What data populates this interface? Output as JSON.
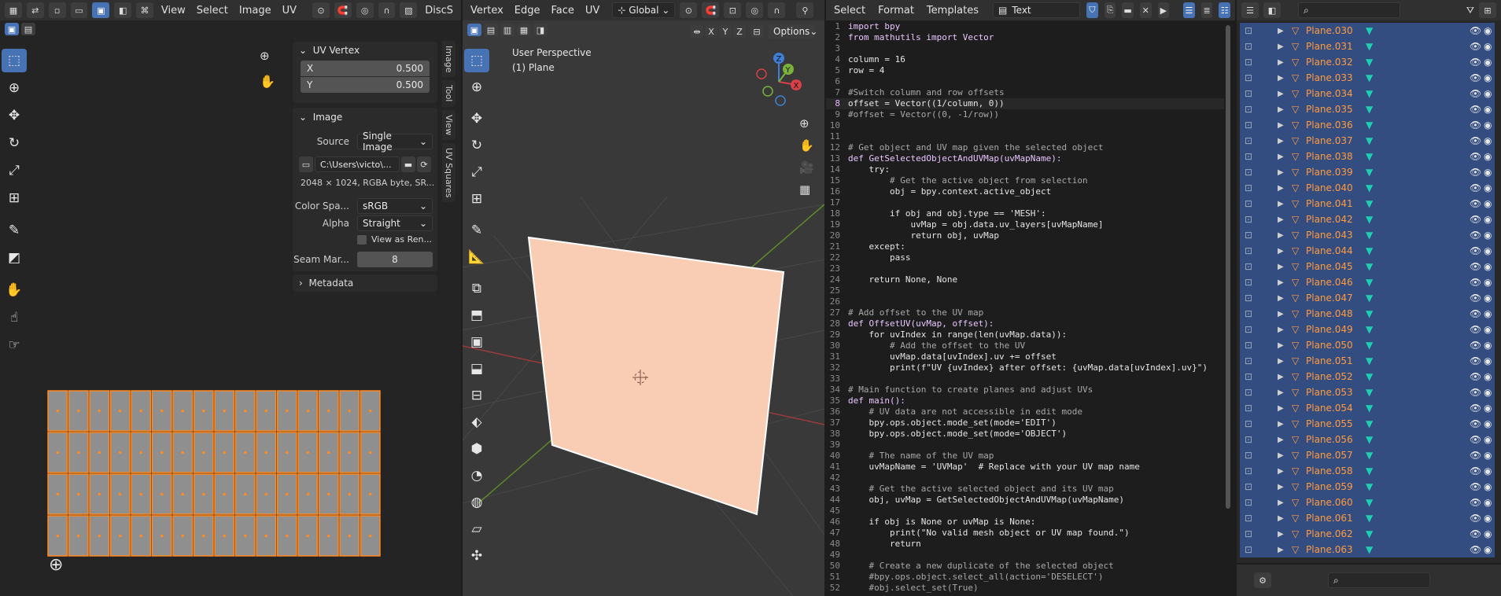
{
  "uv_editor": {
    "menus": [
      "View",
      "Select",
      "Image",
      "UV"
    ],
    "header_trunc": "DiscS",
    "tabs": [
      "Image",
      "Tool",
      "View",
      "UV Squares"
    ],
    "uv_vertex_panel": {
      "title": "UV Vertex",
      "x_label": "X",
      "x_value": "0.500",
      "y_label": "Y",
      "y_value": "0.500"
    },
    "image_panel": {
      "title": "Image",
      "source_label": "Source",
      "source_value": "Single Image",
      "path": "C:\\Users\\victo\\...",
      "info": "2048 × 1024,  RGBA byte,  SR...",
      "colorspace_label": "Color Spa...",
      "colorspace_value": "sRGB",
      "alpha_label": "Alpha",
      "alpha_value": "Straight",
      "view_as_render": "View as Ren...",
      "seam_label": "Seam Mar...",
      "seam_value": "8"
    },
    "metadata_title": "Metadata",
    "grid": {
      "columns": 16,
      "rows": 4
    }
  },
  "viewport": {
    "menus": [
      "Vertex",
      "Edge",
      "Face",
      "UV"
    ],
    "transform_orientation": "Global",
    "options": "Options",
    "axis_lock": [
      "X",
      "Y",
      "Z"
    ],
    "title": "User Perspective",
    "subtitle": "(1) Plane",
    "gizmo": {
      "x": "X",
      "y": "Y",
      "z": "Z"
    },
    "colors": {
      "plane": "#f9ccb4",
      "x_axis": "#9b3a3a",
      "y_axis": "#5f8a2a"
    }
  },
  "text_editor": {
    "menus": [
      "Select",
      "Format",
      "Templates"
    ],
    "file_name": "Text",
    "lines": [
      "import bpy",
      "from mathutils import Vector",
      "",
      "column = 16",
      "row = 4",
      "",
      "#Switch column and row offsets",
      "offset = Vector((1/column, 0))",
      "#offset = Vector((0, -1/row))",
      "",
      "",
      "# Get object and UV map given the selected object",
      "def GetSelectedObjectAndUVMap(uvMapName):",
      "    try:",
      "        # Get the active object from selection",
      "        obj = bpy.context.active_object",
      "",
      "        if obj and obj.type == 'MESH':",
      "            uvMap = obj.data.uv_layers[uvMapName]",
      "            return obj, uvMap",
      "    except:",
      "        pass",
      "",
      "    return None, None",
      "",
      "",
      "# Add offset to the UV map",
      "def OffsetUV(uvMap, offset):",
      "    for uvIndex in range(len(uvMap.data)):",
      "        # Add the offset to the UV",
      "        uvMap.data[uvIndex].uv += offset",
      "        print(f\"UV {uvIndex} after offset: {uvMap.data[uvIndex].uv}\")",
      "",
      "# Main function to create planes and adjust UVs",
      "def main():",
      "    # UV data are not accessible in edit mode",
      "    bpy.ops.object.mode_set(mode='EDIT')",
      "    bpy.ops.object.mode_set(mode='OBJECT')",
      "",
      "    # The name of the UV map",
      "    uvMapName = 'UVMap'  # Replace with your UV map name",
      "",
      "    # Get the active selected object and its UV map",
      "    obj, uvMap = GetSelectedObjectAndUVMap(uvMapName)",
      "",
      "    if obj is None or uvMap is None:",
      "        print(\"No valid mesh object or UV map found.\")",
      "        return",
      "",
      "    # Create a new duplicate of the selected object",
      "    #bpy.ops.object.select_all(action='DESELECT')",
      "    #obj.select_set(True)"
    ]
  },
  "outliner": {
    "items": [
      "Plane.030",
      "Plane.031",
      "Plane.032",
      "Plane.033",
      "Plane.034",
      "Plane.035",
      "Plane.036",
      "Plane.037",
      "Plane.038",
      "Plane.039",
      "Plane.040",
      "Plane.041",
      "Plane.042",
      "Plane.043",
      "Plane.044",
      "Plane.045",
      "Plane.046",
      "Plane.047",
      "Plane.048",
      "Plane.049",
      "Plane.050",
      "Plane.051",
      "Plane.052",
      "Plane.053",
      "Plane.054",
      "Plane.055",
      "Plane.056",
      "Plane.057",
      "Plane.058",
      "Plane.059",
      "Plane.060",
      "Plane.061",
      "Plane.062",
      "Plane.063"
    ],
    "colors": {
      "selected_bg": "#334d80",
      "name": "#ff9b3f",
      "mesh_icon": "#1fd0b0"
    }
  }
}
